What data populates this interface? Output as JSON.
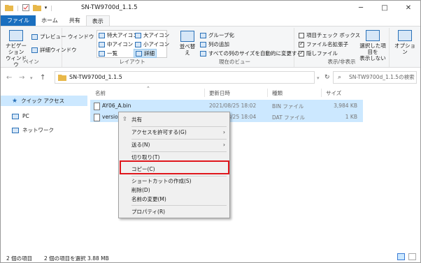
{
  "window": {
    "title": "SN-TW9700d_1.1.5",
    "minimize": "─",
    "maximize": "□",
    "close": "✕"
  },
  "tabs": [
    "ファイル",
    "ホーム",
    "共有",
    "表示"
  ],
  "ribbon": {
    "pane_group": {
      "nav_pane": "ナビゲーション",
      "nav_pane2": "ウィンドウ",
      "preview": "プレビュー ウィンドウ",
      "details_pane": "詳細ウィンドウ",
      "label": "ペイン"
    },
    "layout_group": {
      "xl_icons": "特大アイコン",
      "l_icons": "大アイコン",
      "m_icons": "中アイコン",
      "s_icons": "小アイコン",
      "list": "一覧",
      "details": "詳細",
      "label": "レイアウト"
    },
    "current_view": {
      "sort": "並べ替え",
      "group_by": "グループ化",
      "add_columns": "列の追加",
      "size_all": "すべての列のサイズを自動的に変更する",
      "label": "現在のビュー"
    },
    "show_hide": {
      "item_checkboxes": "項目チェック ボックス",
      "extensions": "ファイル名拡張子",
      "hidden": "隠しファイル",
      "hide_sel1": "選択した項目を",
      "hide_sel2": "表示しない",
      "label": "表示/非表示"
    },
    "options": "オプション"
  },
  "address": {
    "path": "SN-TW9700d_1.1.5",
    "search_placeholder": "SN-TW9700d_1.1.5の検索"
  },
  "nav_pane": {
    "quick_access": "クイック アクセス",
    "pc": "PC",
    "network": "ネットワーク"
  },
  "columns": {
    "name": "名前",
    "date": "更新日時",
    "type": "種類",
    "size": "サイズ"
  },
  "files": [
    {
      "name": "AY06_A.bin",
      "date": "2021/08/25 18:02",
      "type": "BIN ファイル",
      "size": "3,984 KB"
    },
    {
      "name": "version",
      "date": "2021/08/25 18:04",
      "type": "DAT ファイル",
      "size": "1 KB"
    }
  ],
  "context_menu": {
    "share": "共有",
    "grant_access": "アクセスを許可する(G)",
    "send_to": "送る(N)",
    "cut": "切り取り(T)",
    "copy": "コピー(C)",
    "create_shortcut": "ショートカットの作成(S)",
    "delete": "削除(D)",
    "rename": "名前の変更(M)",
    "properties": "プロパティ(R)",
    "arrow": "›"
  },
  "status": {
    "item_count": "2 個の項目",
    "selected": "2 個の項目を選択 3.88 MB"
  },
  "colors": {
    "file_tab": "#1a6fbf",
    "selection": "#cce8ff",
    "highlight": "#e0161c"
  }
}
